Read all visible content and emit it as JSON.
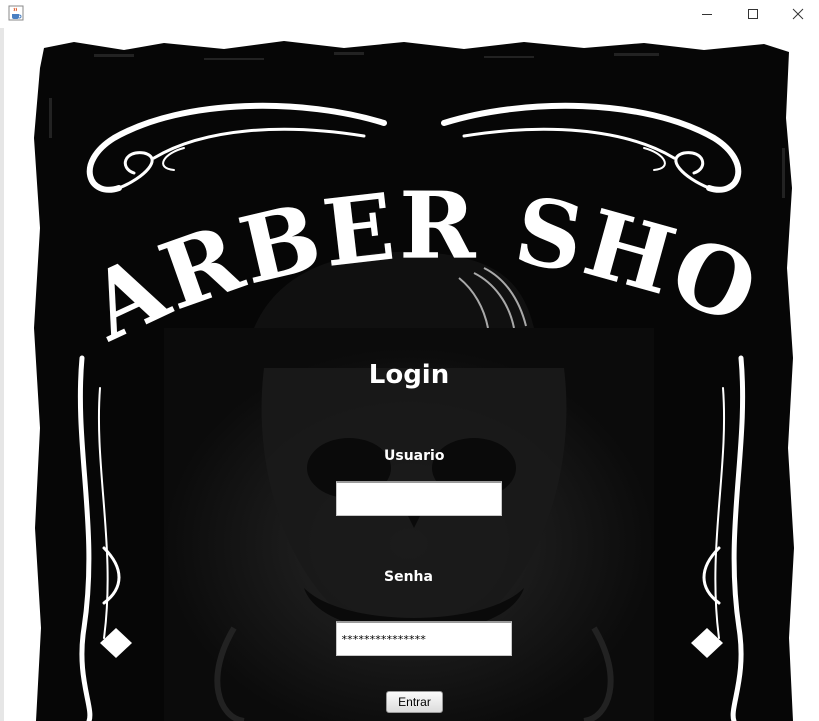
{
  "window": {
    "app_icon": "java-coffee-cup-icon",
    "controls": [
      "minimize-icon",
      "maximize-icon",
      "close-icon"
    ]
  },
  "poster": {
    "brand_title": "BARBER SHOP"
  },
  "login": {
    "title": "Login",
    "username_label": "Usuario",
    "username_value": "",
    "password_label": "Senha",
    "password_value": "***************",
    "submit_label": "Entrar"
  },
  "colors": {
    "poster_background": "#050505",
    "ornament": "#ffffff",
    "panel_text": "#ffffff"
  }
}
